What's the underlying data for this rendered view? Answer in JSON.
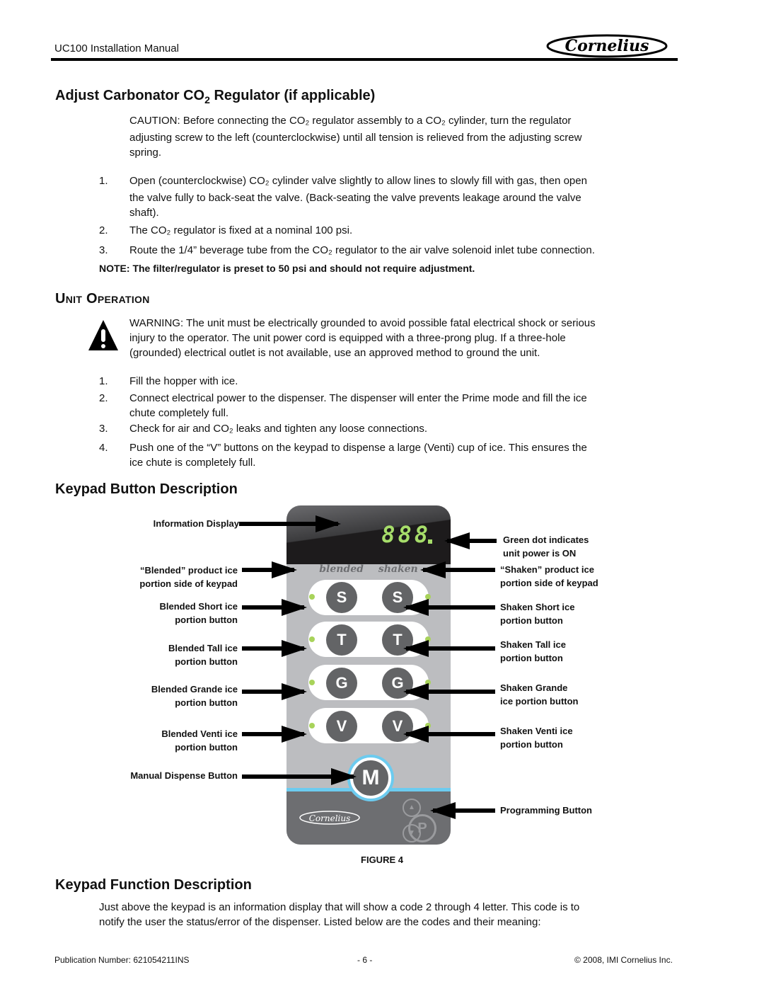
{
  "header": {
    "manual_title": "UC100 Installation Manual",
    "logo_text": "Cornelius"
  },
  "section_co2": {
    "heading_pre": "Adjust Carbonator CO",
    "heading_sub": "2",
    "heading_post": " Regulator (if applicable)",
    "caution_lines": [
      "CAUTION: Before connecting the CO₂ regulator assembly to a CO₂ cylinder, turn the regulator",
      "adjusting screw to the left (counterclockwise) until all tension is relieved from the adjusting screw",
      "spring."
    ],
    "steps": [
      {
        "num": "1.",
        "lines": [
          "Open (counterclockwise) CO₂ cylinder valve slightly to allow lines to slowly fill with gas, then open",
          "the valve fully to back-seat the valve. (Back-seating the valve prevents leakage around the valve",
          "shaft)."
        ]
      },
      {
        "num": "2.",
        "lines": [
          "The CO₂ regulator is fixed at a nominal 100 psi."
        ]
      },
      {
        "num": "3.",
        "lines": [
          "Route the 1/4” beverage tube from the CO₂ regulator to the air valve solenoid inlet tube connection."
        ]
      }
    ],
    "note": "NOTE:  The filter/regulator is preset to 50 psi and should not require adjustment."
  },
  "section_unit": {
    "heading": "Unit Operation",
    "warning_lines": [
      "WARNING: The unit must be electrically grounded to avoid possible fatal electrical shock or serious",
      "injury to the operator. The unit power cord is equipped with a three-prong plug. If a three-hole",
      "(grounded) electrical outlet is not available, use an approved method to ground the unit."
    ],
    "steps": [
      {
        "num": "1.",
        "lines": [
          "Fill the hopper with ice."
        ]
      },
      {
        "num": "2.",
        "lines": [
          "Connect electrical power to the dispenser. The dispenser will enter the Prime mode and fill the ice",
          "chute completely full."
        ]
      },
      {
        "num": "3.",
        "lines": [
          "Check for air and CO₂ leaks and tighten any loose connections."
        ]
      },
      {
        "num": "4.",
        "lines": [
          "Push one of the “V” buttons on the keypad to dispense a large (Venti) cup of ice. This ensures the",
          "ice chute is completely full."
        ]
      }
    ]
  },
  "section_keypad": {
    "heading": "Keypad Button Description",
    "keypad": {
      "display_digits": "888",
      "label_left": "blended",
      "label_right": "shaken",
      "rows": [
        "S",
        "T",
        "G",
        "V"
      ],
      "manual_key": "M",
      "program_key": "P",
      "up_glyph": "▲",
      "down_glyph": "▼",
      "logo_text": "Cornelius"
    },
    "callouts_left": [
      [
        "Information Display"
      ],
      [
        "“Blended” product ice",
        "portion side of keypad"
      ],
      [
        "Blended Short ice",
        "portion button"
      ],
      [
        "Blended Tall ice",
        "portion button"
      ],
      [
        "Blended Grande ice",
        "portion button"
      ],
      [
        "Blended Venti ice",
        "portion button"
      ],
      [
        "Manual Dispense Button"
      ]
    ],
    "callouts_right": [
      [
        "Green dot indicates",
        "unit power is ON"
      ],
      [
        "“Shaken” product ice",
        "portion side of keypad"
      ],
      [
        "Shaken Short ice",
        "portion button"
      ],
      [
        "Shaken Tall ice",
        "portion button"
      ],
      [
        "Shaken Grande",
        "ice portion button"
      ],
      [
        "Shaken Venti ice",
        "portion button"
      ],
      [
        "Programming Button"
      ]
    ],
    "figure_caption": "FIGURE 4"
  },
  "section_function": {
    "heading": "Keypad Function Description",
    "lines": [
      "Just above the keypad is an information display that will show a code 2 through 4 letter. This code is to",
      "notify the user the status/error of the dispenser. Listed below are the codes and their meaning:"
    ]
  },
  "footer": {
    "publication": "Publication Number: 621054211INS",
    "page": "- 6 -",
    "copyright": "© 2008, IMI Cornelius Inc."
  }
}
